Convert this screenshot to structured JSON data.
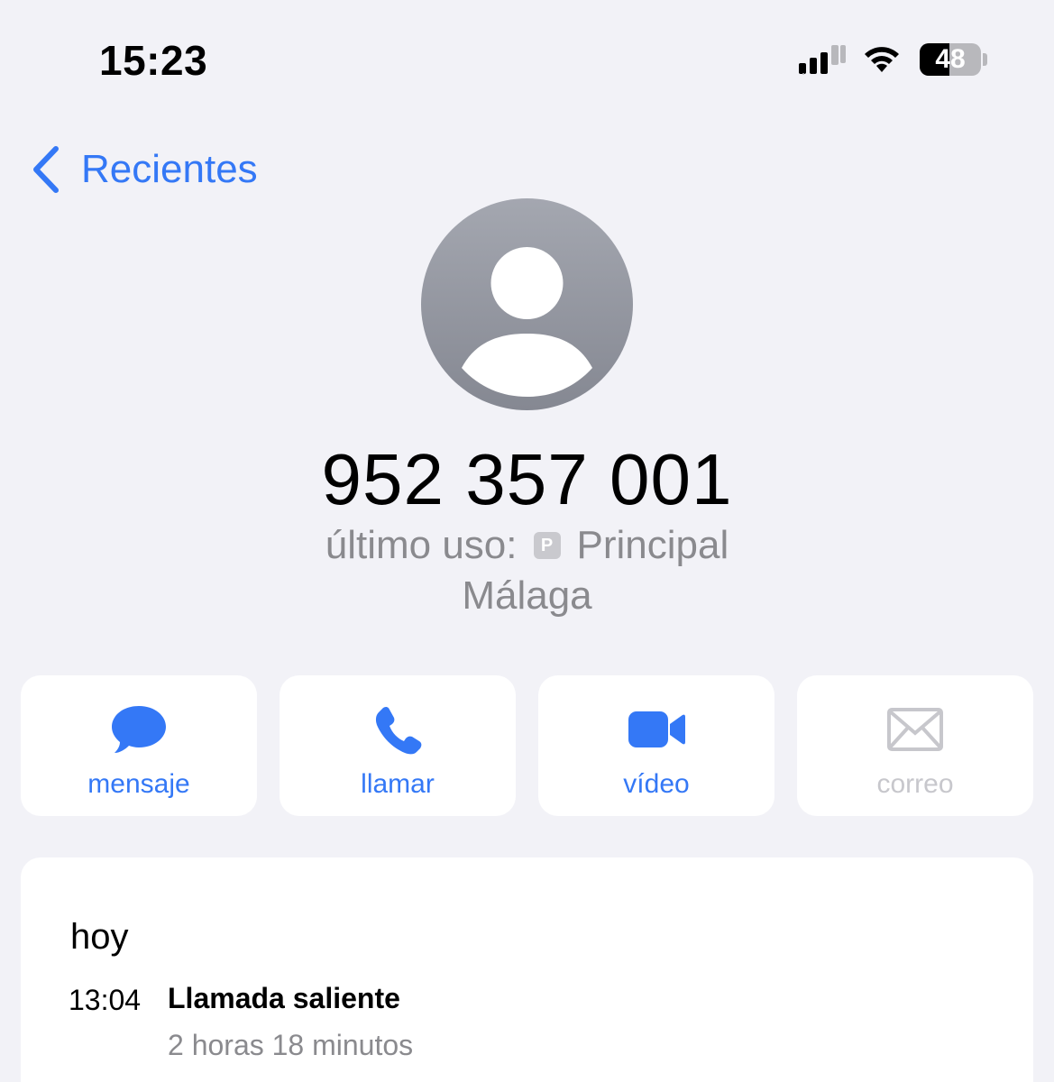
{
  "status_bar": {
    "time": "15:23",
    "battery_level": "48",
    "battery_fraction": 0.48,
    "signal_icon": "cellular-signal-icon",
    "wifi_icon": "wifi-icon"
  },
  "nav": {
    "back_label": "Recientes",
    "back_icon": "chevron-left-icon"
  },
  "contact": {
    "avatar_icon": "person-placeholder-icon",
    "phone_number": "952 357 001",
    "last_used_label": "último uso:",
    "line_badge": "P",
    "line_name": "Principal",
    "location": "Málaga"
  },
  "actions": [
    {
      "label": "mensaje",
      "icon": "message-bubble-icon",
      "enabled": true
    },
    {
      "label": "llamar",
      "icon": "phone-icon",
      "enabled": true
    },
    {
      "label": "vídeo",
      "icon": "video-camera-icon",
      "enabled": true
    },
    {
      "label": "correo",
      "icon": "envelope-icon",
      "enabled": false
    }
  ],
  "history": {
    "day": "hoy",
    "entries": [
      {
        "time": "13:04",
        "type": "Llamada saliente",
        "duration": "2 horas 18 minutos"
      }
    ]
  },
  "colors": {
    "accent": "#3478f6",
    "background": "#f2f2f7",
    "secondary_text": "#8a8a8e",
    "disabled": "#c7c7cc"
  }
}
